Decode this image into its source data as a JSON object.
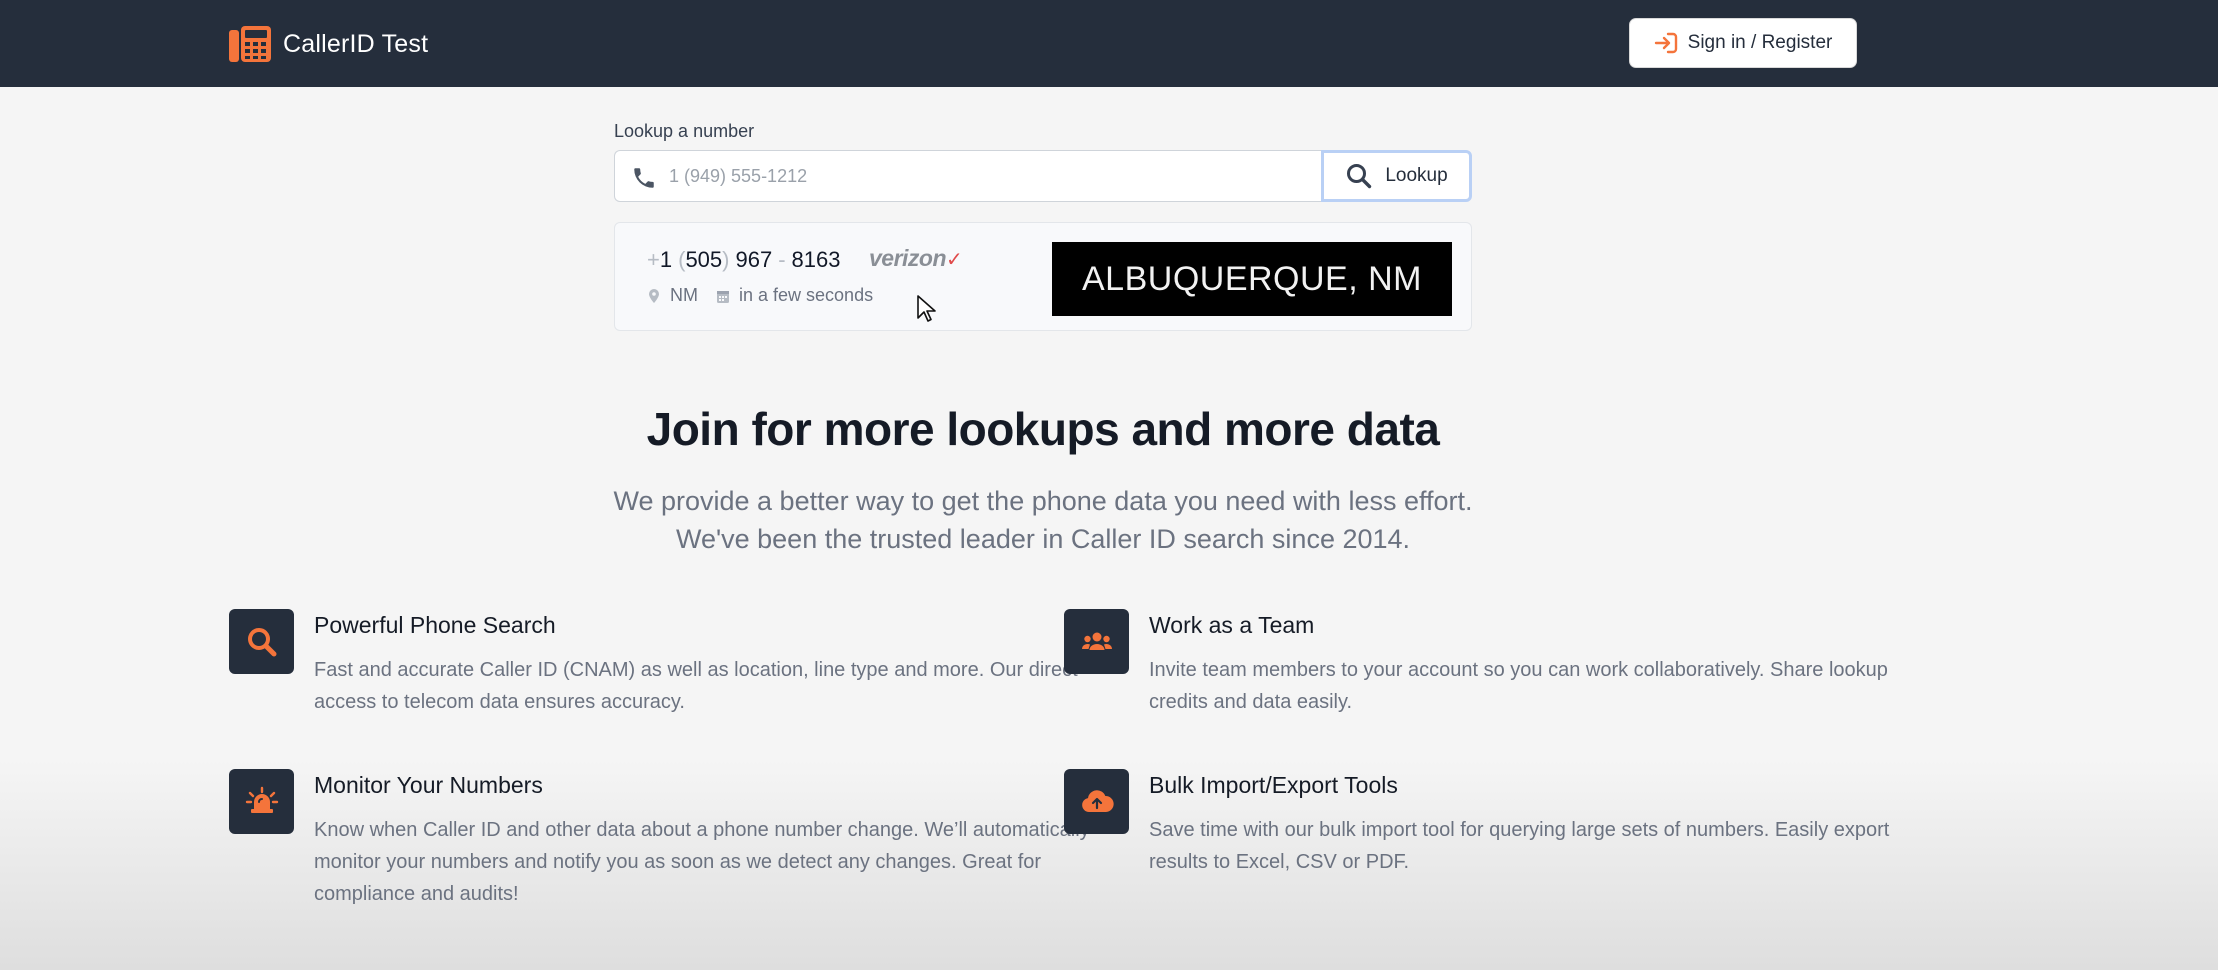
{
  "colors": {
    "navbar": "#252e3c",
    "accent": "#f4743b",
    "icon_tile": "#252e3c"
  },
  "navbar": {
    "brand_name": "CallerID Test",
    "brand_icon": "phone-keypad-logo-icon",
    "signin_label": "Sign in / Register",
    "signin_icon": "sign-in-arrow-icon"
  },
  "lookup": {
    "label": "Lookup a number",
    "placeholder": "1 (949) 555-1212",
    "value": "",
    "button_label": "Lookup",
    "input_icon": "phone-icon",
    "button_icon": "search-icon"
  },
  "result": {
    "plus": "+",
    "country_code": "1",
    "open_paren": "(",
    "area_code": "505",
    "close_paren": ")",
    "exchange": "967",
    "dash": "-",
    "line": "8163",
    "carrier": "verizon",
    "carrier_mark": "✓",
    "state": "NM",
    "timestamp": "in a few seconds",
    "city": "ALBUQUERQUE, NM"
  },
  "hero": {
    "title": "Join for more lookups and more data",
    "subtitle": "We provide a better way to get the phone data you need with less effort. We've been the trusted leader in Caller ID search since 2014."
  },
  "features": [
    {
      "icon": "search-icon",
      "title": "Powerful Phone Search",
      "description": "Fast and accurate Caller ID (CNAM) as well as location, line type and more. Our direct access to telecom data ensures accuracy."
    },
    {
      "icon": "team-icon",
      "title": "Work as a Team",
      "description": "Invite team members to your account so you can work collaboratively. Share lookup credits and data easily."
    },
    {
      "icon": "alarm-light-icon",
      "title": "Monitor Your Numbers",
      "description": "Know when Caller ID and other data about a phone number change. We’ll automatically monitor your numbers and notify you as soon as we detect any changes. Great for compliance and audits!"
    },
    {
      "icon": "cloud-upload-icon",
      "title": "Bulk Import/Export Tools",
      "description": "Save time with our bulk import tool for querying large sets of numbers. Easily export results to Excel, CSV or PDF."
    }
  ]
}
